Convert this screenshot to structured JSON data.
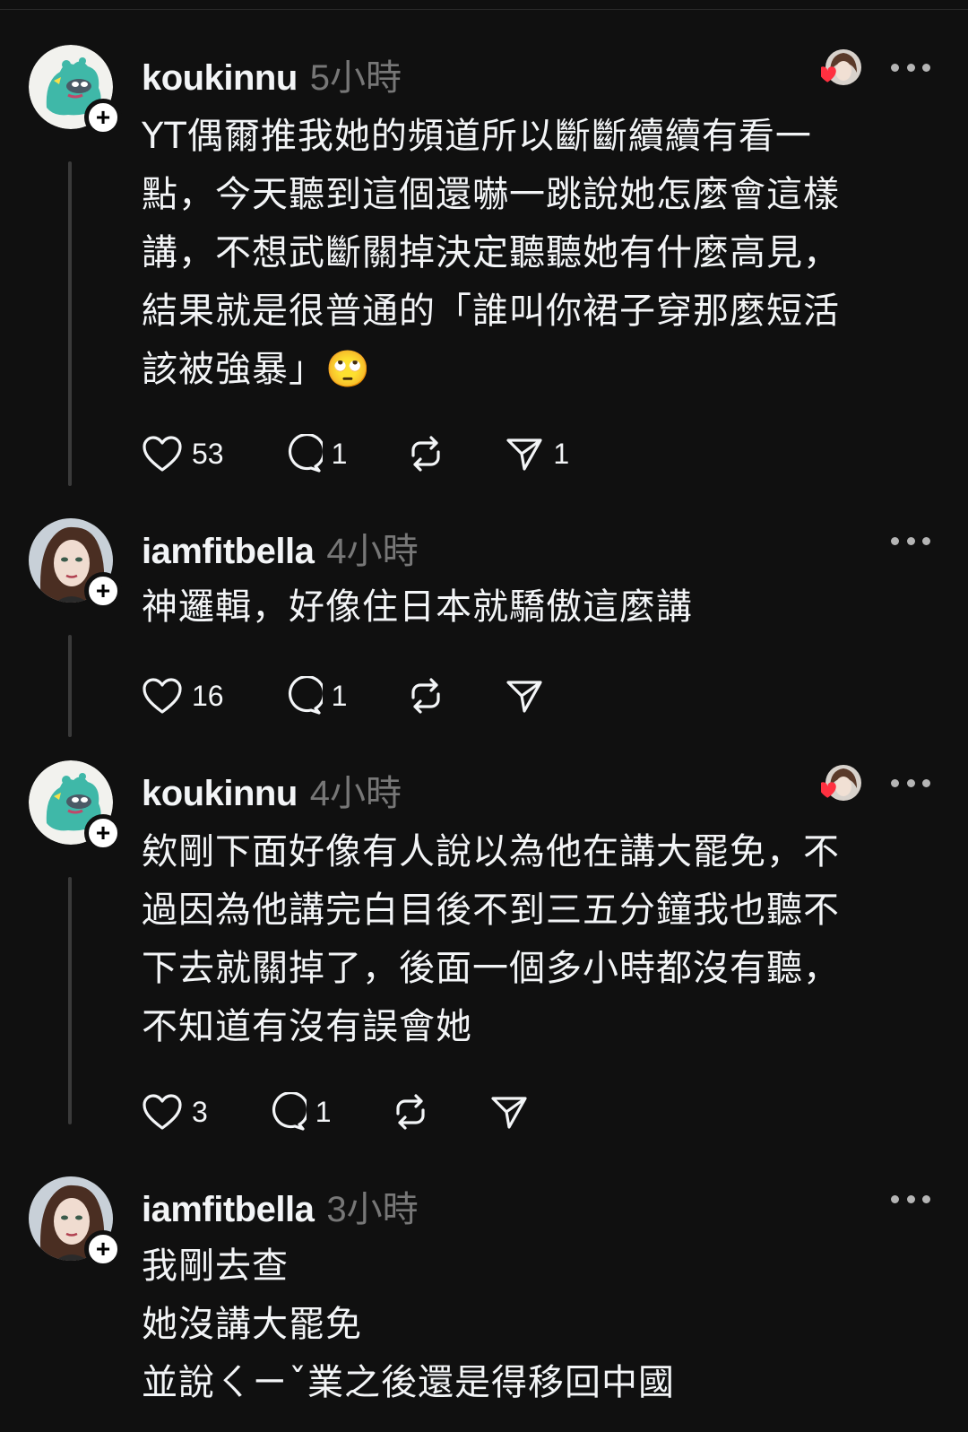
{
  "posts": [
    {
      "username": "koukinnu",
      "time": "5小時",
      "text": "YT偶爾推我她的頻道所以斷斷續續有看一\n點，今天聽到這個還嚇一跳說她怎麼會這樣\n講，不想武斷關掉決定聽聽她有什麼高見，\n結果就是很普通的「誰叫你裙子穿那麼短活\n該被強暴」🙄",
      "likes": "53",
      "replies": "1",
      "reposts": "",
      "shares": "1",
      "avatar_icon": "green-mascot-avatar",
      "liked_by_author": true
    },
    {
      "username": "iamfitbella",
      "time": "4小時",
      "text": "神邏輯，好像住日本就驕傲這麼講",
      "likes": "16",
      "replies": "1",
      "reposts": "",
      "shares": "",
      "avatar_icon": "woman-portrait-avatar",
      "liked_by_author": false
    },
    {
      "username": "koukinnu",
      "time": "4小時",
      "text": "欸剛下面好像有人說以為他在講大罷免，不\n過因為他講完白目後不到三五分鐘我也聽不\n下去就關掉了，後面一個多小時都沒有聽，\n不知道有沒有誤會她",
      "likes": "3",
      "replies": "1",
      "reposts": "",
      "shares": "",
      "avatar_icon": "green-mascot-avatar",
      "liked_by_author": true
    },
    {
      "username": "iamfitbella",
      "time": "3小時",
      "text": "我剛去查\n她沒講大罷免\n並說ㄑㄧˇ業之後還是得移回中國",
      "avatar_icon": "woman-portrait-avatar",
      "liked_by_author": false
    }
  ],
  "colors": {
    "background": "#101010",
    "text": "#f3f5f7",
    "muted": "#777777",
    "heart": "#ff3040",
    "mascot": "#3fb8a8"
  }
}
